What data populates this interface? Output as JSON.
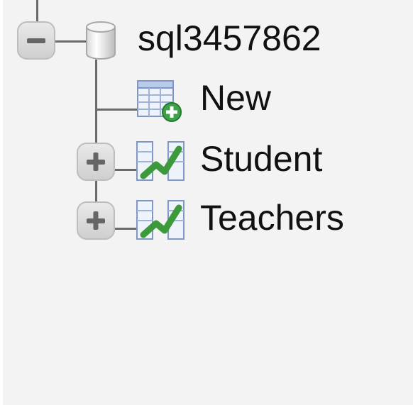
{
  "tree": {
    "database": {
      "name": "sql3457862",
      "icon": "database-icon",
      "toggle": "collapse-minus-icon"
    },
    "items": [
      {
        "label": "New",
        "icon": "new-table-icon"
      },
      {
        "label": "Student",
        "icon": "table-icon",
        "toggle": "expand-plus-icon"
      },
      {
        "label": "Teachers",
        "icon": "table-icon",
        "toggle": "expand-plus-icon"
      }
    ]
  }
}
